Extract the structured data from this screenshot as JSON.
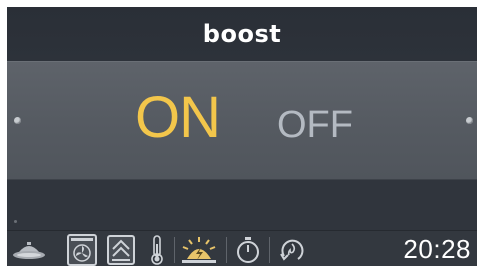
{
  "title": "boost",
  "options": {
    "on_label": "ON",
    "off_label": "OFF",
    "selected": "ON"
  },
  "status_bar": {
    "icons": [
      "cooktop-lid-icon",
      "fan-oven-icon",
      "steam-icon",
      "thermometer-icon",
      "boost-sun-icon",
      "timer-icon",
      "pyro-clean-icon"
    ],
    "clock": "20:28"
  },
  "colors": {
    "selected": "#f3c64b",
    "unselected": "#b4bac2",
    "background": "#2f343c"
  }
}
